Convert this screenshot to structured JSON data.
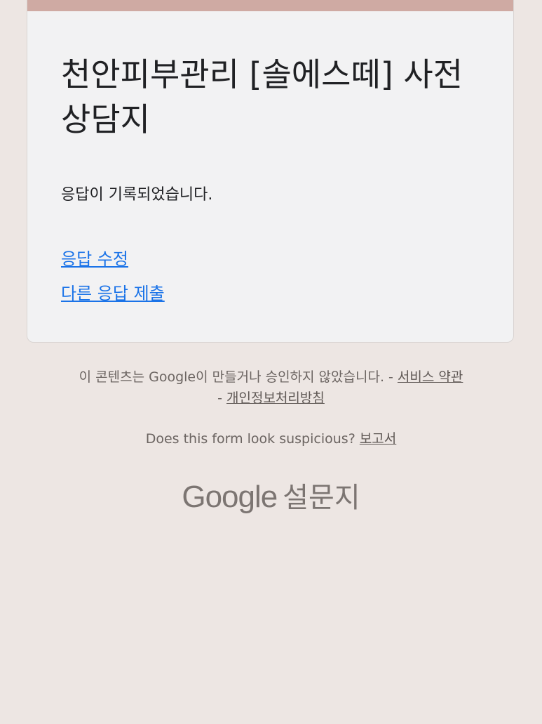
{
  "card": {
    "title": "천안피부관리 [솔에스떼] 사전 상담지",
    "confirmation": "응답이 기록되었습니다.",
    "edit_link": "응답 수정",
    "submit_another_link": "다른 응답 제출",
    "accent_color": "#cfaaa3"
  },
  "footer": {
    "disclaimer_prefix": "이 콘텐츠는 Google이 만들거나 승인하지 않았습니다. - ",
    "terms_link": "서비스 약관",
    "privacy_separator": "- ",
    "privacy_link": "개인정보처리방침",
    "suspicious_text": "Does this form look suspicious? ",
    "report_link": "보고서"
  },
  "brand": {
    "google": "Google",
    "product": "설문지"
  },
  "colors": {
    "background": "#ede6e3",
    "card_background": "#f2f2f3",
    "link": "#1a73e8"
  }
}
